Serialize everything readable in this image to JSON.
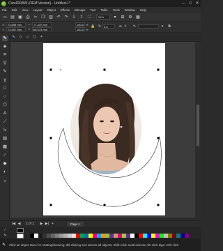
{
  "window": {
    "title": "CorelDRAW (OEM Version) - Untitled-1*",
    "minimize": "–",
    "maximize": "□",
    "close": "✕"
  },
  "menu": [
    "File",
    "Edit",
    "View",
    "Layout",
    "Object",
    "Effects",
    "Bitmaps",
    "Text",
    "Table",
    "Tools",
    "Window",
    "Help"
  ],
  "toolbar": {
    "zoom": "51%",
    "icons": [
      "new-icon",
      "open-icon",
      "save-icon",
      "print-icon",
      "cut-icon",
      "copy-icon",
      "paste-icon",
      "undo-icon",
      "redo-icon",
      "import-icon",
      "export-icon"
    ]
  },
  "property_bar": {
    "x": "73.505 mm",
    "y": "73.507 mm",
    "width": "77.337 mm",
    "height": "68.573 mm",
    "scale_x": "100.0",
    "scale_y": "100.0",
    "scale_unit": "%",
    "rotation": "0.0",
    "outline": "",
    "x_label": "X:",
    "y_label": "Y:"
  },
  "page_nav": {
    "first": "|◀",
    "prev": "◀",
    "page_count": "1 of 1",
    "next": "▶",
    "last": "▶|",
    "add": "+",
    "page_label": "Page 1"
  },
  "colors": {
    "canvas_bg": "#3c3c3c",
    "page": "#ffffff",
    "accent": "#4aa3ff",
    "palette": [
      "#000000",
      "#ffffff",
      "#1a1a1a",
      "#333333",
      "#4d4d4d",
      "#666666",
      "#808080",
      "#999999",
      "#b3b3b3",
      "#cccccc",
      "#e6e6e6",
      "#ff0000",
      "#00a651",
      "#0072bc",
      "#ffff00",
      "#ec008c",
      "#00aeef",
      "#f7941d",
      "#8dc63f",
      "#662d91",
      "#c69c6d",
      "#e6007e",
      "#a2ca3c",
      "#5c2d91",
      "#ffffff",
      "#000000",
      "#ff0000",
      "#00ffff",
      "#0000ff",
      "#ffff00",
      "#ff00ff",
      "#00ff00",
      "#c0c0c0",
      "#808000",
      "#800000",
      "#008080",
      "#000080",
      "#800080"
    ]
  },
  "status": {
    "text": "Click an object twice for rotating/skewing; dbl-clicking tool selects all objects; Shift+click multi-selects; Alt+click digs; Ctrl+click"
  }
}
